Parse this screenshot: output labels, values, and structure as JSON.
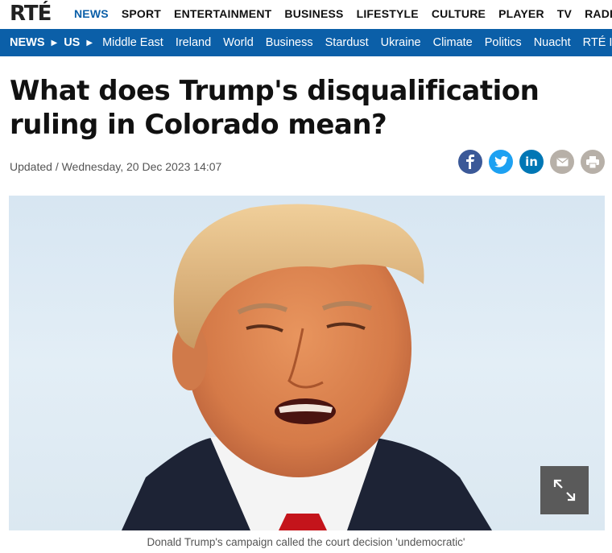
{
  "brand": {
    "logo_text": "RTÉ",
    "accent": "#0b5fa8"
  },
  "top_nav": [
    "NEWS",
    "SPORT",
    "ENTERTAINMENT",
    "BUSINESS",
    "LIFESTYLE",
    "CULTURE",
    "PLAYER",
    "TV",
    "RADIO"
  ],
  "section_nav": {
    "breadcrumb": [
      "NEWS",
      "US"
    ],
    "items": [
      "Middle East",
      "Ireland",
      "World",
      "Business",
      "Stardust",
      "Ukraine",
      "Climate",
      "Politics",
      "Nuacht",
      "RTÉ I"
    ]
  },
  "article": {
    "title": "What does Trump's disqualification ruling in Colorado mean?",
    "updated": "Updated / Wednesday, 20 Dec 2023 14:07",
    "caption": "Donald Trump's campaign called the court decision 'undemocratic'"
  },
  "share_icons": [
    "facebook-icon",
    "twitter-icon",
    "linkedin-icon",
    "email-icon",
    "print-icon"
  ],
  "colors": {
    "facebook": "#3b5998",
    "twitter": "#1da1f2",
    "linkedin": "#0077b5",
    "neutral": "#b7b0a8",
    "caption": "#555555"
  }
}
